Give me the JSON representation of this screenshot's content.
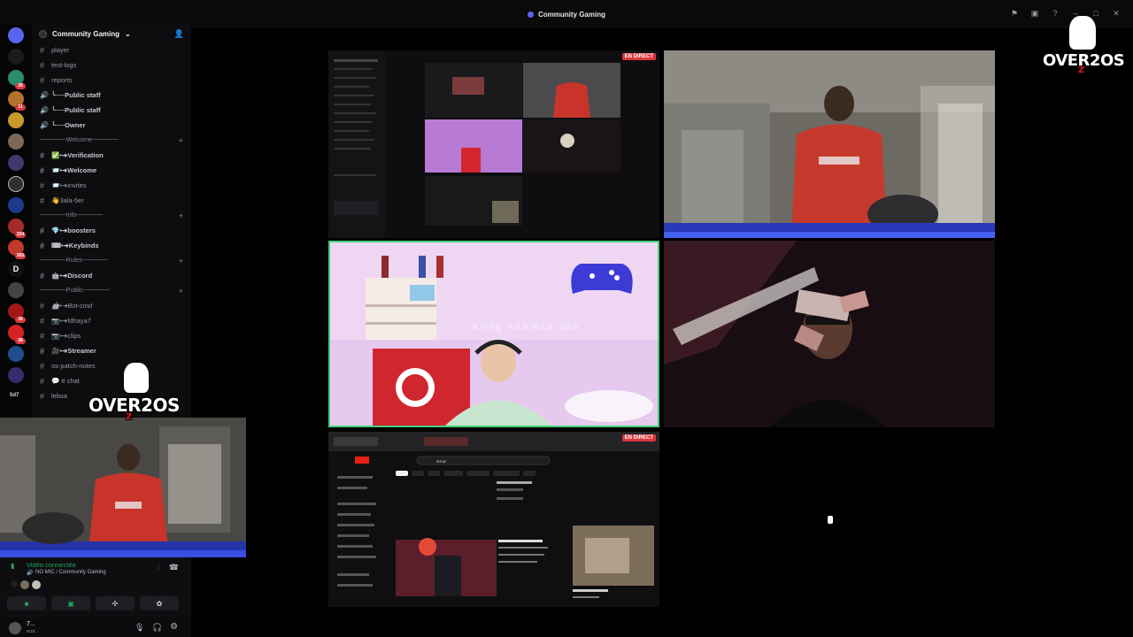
{
  "window": {
    "title": "Community Gaming"
  },
  "server": {
    "name": "Community Gaming"
  },
  "channels": [
    {
      "type": "text",
      "label": "player"
    },
    {
      "type": "text",
      "label": "test-logs"
    },
    {
      "type": "text",
      "label": "reports"
    },
    {
      "type": "voice",
      "label": "╰──Public staff",
      "strong": true
    },
    {
      "type": "voice",
      "label": "╰──Public staff",
      "strong": true
    },
    {
      "type": "voice",
      "label": "╰──Owner",
      "strong": true
    },
    {
      "type": "category",
      "label": "──────Welcome──────"
    },
    {
      "type": "text",
      "label": "✅•➜Verification",
      "strong": true
    },
    {
      "type": "text",
      "label": "📨•➜Welcome",
      "strong": true
    },
    {
      "type": "text",
      "label": "📨•➜invites"
    },
    {
      "type": "text",
      "label": "👋3ala-5er"
    },
    {
      "type": "category",
      "label": "──────Info──────"
    },
    {
      "type": "text",
      "label": "💎•➜boosters",
      "strong": true
    },
    {
      "type": "text",
      "label": "⌨•➜Keybinds",
      "strong": true
    },
    {
      "type": "category",
      "label": "──────Rules──────"
    },
    {
      "type": "text",
      "label": "🤖•➜Discord",
      "strong": true
    },
    {
      "type": "category",
      "label": "──────Public──────"
    },
    {
      "type": "text",
      "label": "🤖•➜Bot-cmd",
      "italic": true
    },
    {
      "type": "text",
      "label": "📷•➜fdhaya7"
    },
    {
      "type": "text",
      "label": "📷•➜clips"
    },
    {
      "type": "text",
      "label": "🎥•➜Streamer",
      "strong": true
    },
    {
      "type": "text",
      "label": "os-patch-notes"
    },
    {
      "type": "text",
      "label": "💬 # chat"
    },
    {
      "type": "text",
      "label": "lebsa"
    }
  ],
  "rail_badges": [
    "26",
    "11",
    "324",
    "265",
    "36",
    "38",
    "5d7"
  ],
  "rail_letter": "D",
  "voice": {
    "status": "Vidéo connectée",
    "sub": "NO MIC / Community Gaming"
  },
  "user": {
    "name": "7...",
    "status": "scot..."
  },
  "live_label": "EN DIRECT",
  "overlay_text": "Aring Asaikaa aan",
  "logo": {
    "text_top": "OVER",
    "num": "2",
    "text_end": "OS",
    "sub": "Z"
  },
  "pip_logo": {
    "text_top": "OVER",
    "num": "2",
    "text_end": "OS",
    "sub": "Z"
  },
  "youtube": {
    "search": "sol.ar"
  },
  "colors": {
    "accent": "#5865f2",
    "live": "#da373c",
    "connected": "#23a55a",
    "speaking": "#43d17a"
  }
}
